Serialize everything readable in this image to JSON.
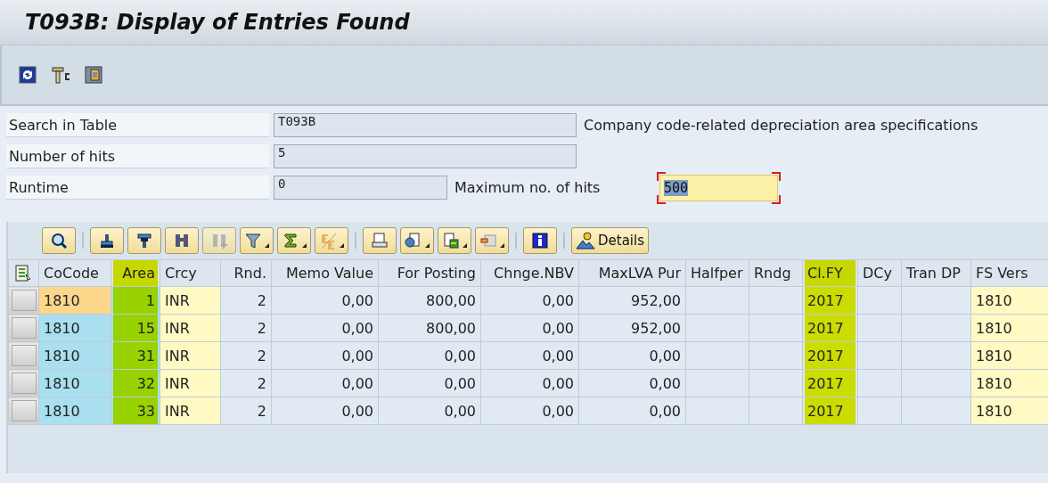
{
  "window": {
    "title": "T093B: Display of Entries Found"
  },
  "search": {
    "fields": [
      {
        "label": "Search in Table",
        "value": "T093B",
        "description": "Company code-related depreciation area specifications"
      },
      {
        "label": "Number of hits",
        "value": "5"
      },
      {
        "label": "Runtime",
        "value": "0",
        "extra_label": "Maximum no. of hits",
        "extra_value": "500"
      }
    ]
  },
  "grid": {
    "details_button": "Details",
    "columns": [
      {
        "label": "CoCode",
        "kind": "key",
        "numeric": false,
        "highlighted": false
      },
      {
        "label": "Area",
        "kind": "key",
        "numeric": true,
        "highlighted": true
      },
      {
        "label": "Crcy",
        "kind": "text",
        "numeric": false,
        "highlighted": false
      },
      {
        "label": "Rnd.",
        "kind": "plain",
        "numeric": true,
        "highlighted": false
      },
      {
        "label": "Memo Value",
        "kind": "plain",
        "numeric": true,
        "highlighted": false
      },
      {
        "label": "For Posting",
        "kind": "plain",
        "numeric": true,
        "highlighted": false
      },
      {
        "label": "Chnge.NBV",
        "kind": "plain",
        "numeric": true,
        "highlighted": false
      },
      {
        "label": "MaxLVA Pur",
        "kind": "plain",
        "numeric": true,
        "highlighted": false
      },
      {
        "label": "Halfper",
        "kind": "plain",
        "numeric": false,
        "highlighted": false
      },
      {
        "label": "Rndg",
        "kind": "plain",
        "numeric": false,
        "highlighted": false
      },
      {
        "label": "Cl.FY",
        "kind": "plain",
        "numeric": false,
        "highlighted": true
      },
      {
        "label": "DCy",
        "kind": "plain",
        "numeric": false,
        "highlighted": false
      },
      {
        "label": "Tran DP",
        "kind": "plain",
        "numeric": false,
        "highlighted": false
      },
      {
        "label": "FS Vers",
        "kind": "text",
        "numeric": false,
        "highlighted": false
      }
    ],
    "rows": [
      {
        "selected": true,
        "cells": [
          "1810",
          "1",
          "INR",
          "2",
          "0,00",
          "800,00",
          "0,00",
          "952,00",
          "",
          "",
          "2017",
          "",
          "",
          "1810"
        ]
      },
      {
        "selected": false,
        "cells": [
          "1810",
          "15",
          "INR",
          "2",
          "0,00",
          "800,00",
          "0,00",
          "952,00",
          "",
          "",
          "2017",
          "",
          "",
          "1810"
        ]
      },
      {
        "selected": false,
        "cells": [
          "1810",
          "31",
          "INR",
          "2",
          "0,00",
          "0,00",
          "0,00",
          "0,00",
          "",
          "",
          "2017",
          "",
          "",
          "1810"
        ]
      },
      {
        "selected": false,
        "cells": [
          "1810",
          "32",
          "INR",
          "2",
          "0,00",
          "0,00",
          "0,00",
          "0,00",
          "",
          "",
          "2017",
          "",
          "",
          "1810"
        ]
      },
      {
        "selected": false,
        "cells": [
          "1810",
          "33",
          "INR",
          "2",
          "0,00",
          "0,00",
          "0,00",
          "0,00",
          "",
          "",
          "2017",
          "",
          "",
          "1810"
        ]
      }
    ]
  }
}
